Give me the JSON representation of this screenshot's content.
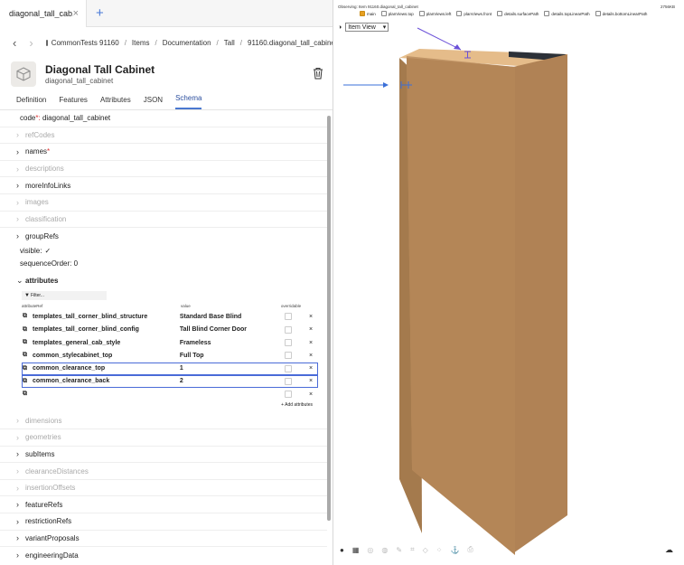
{
  "tabs": {
    "label": "diagonal_tall_cab...",
    "close": "×",
    "add": "+"
  },
  "breadcrumb": {
    "back": "‹",
    "forward": "›",
    "items": [
      "CommonTests 91160",
      "Items",
      "Documentation",
      "Tall",
      "91160.diagonal_tall_cabinet"
    ],
    "sep": "/"
  },
  "header": {
    "title": "Diagonal Tall Cabinet",
    "subtitle": "diagonal_tall_cabinet"
  },
  "subtabs": [
    "Definition",
    "Features",
    "Attributes",
    "JSON",
    "Schema"
  ],
  "props": {
    "code_label": "code",
    "code_req": "*:",
    "code_value": "diagonal_tall_cabinet",
    "refCodes": "refCodes",
    "names": "names",
    "names_req": "*",
    "descriptions": "descriptions",
    "moreInfoLinks": "moreInfoLinks",
    "images": "images",
    "classification": "classification",
    "groupRefs": "groupRefs",
    "visible_label": "visible:",
    "visible_check": "✓",
    "sequenceOrder_label": "sequenceOrder:",
    "sequenceOrder_value": "0",
    "attributes": "attributes",
    "dimensions": "dimensions",
    "geometries": "geometries",
    "subItems": "subItems",
    "clearanceDistances": "clearanceDistances",
    "insertionOffsets": "insertionOffsets",
    "featureRefs": "featureRefs",
    "restrictionRefs": "restrictionRefs",
    "variantProposals": "variantProposals",
    "engineeringData": "engineeringData"
  },
  "attr_table": {
    "filter_placeholder": "Filter...",
    "headers": {
      "ref": "attributeRef",
      "value": "value",
      "overridable": "overridable"
    },
    "rows": [
      {
        "ref": "templates_tall_corner_blind_structure",
        "value": "Standard Base Blind"
      },
      {
        "ref": "templates_tall_corner_blind_config",
        "value": "Tall Blind Corner Door"
      },
      {
        "ref": "templates_general_cab_style",
        "value": "Frameless"
      },
      {
        "ref": "common_stylecabinet_top",
        "value": "Full Top"
      },
      {
        "ref": "common_clearance_top",
        "value": "1"
      },
      {
        "ref": "common_clearance_back",
        "value": "2"
      },
      {
        "ref": "",
        "value": ""
      }
    ],
    "delete": "×",
    "add_label": "+ Add attributes"
  },
  "viewer": {
    "observing": "Observing: Item 91160.diagonal_tall_cabinet",
    "size": "2756KB",
    "layers": [
      "main",
      "planViews.top",
      "planViews.left",
      "planViews.front",
      "details.surfacePath",
      "details.topLinearPath",
      "details.bottomLinearPath"
    ],
    "view_label": "Item View",
    "view_arrow": "▾"
  },
  "colors": {
    "accent": "#4a78d0",
    "selection": "#4a6bd8",
    "arrow": "#6a4fd8",
    "wood": "#b08255",
    "wood_light": "#e5bc8a"
  }
}
